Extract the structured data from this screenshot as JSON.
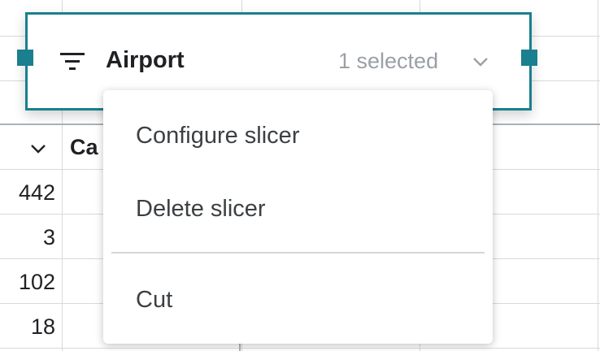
{
  "slicer": {
    "title": "Airport",
    "status": "1 selected"
  },
  "column_header": {
    "label": "Ca"
  },
  "cells": [
    "442",
    "3",
    "102",
    "18"
  ],
  "menu": {
    "items": [
      {
        "label": "Configure slicer"
      },
      {
        "label": "Delete slicer"
      },
      {
        "label": "Cut"
      }
    ]
  },
  "colors": {
    "accent": "#1a7f8e"
  }
}
